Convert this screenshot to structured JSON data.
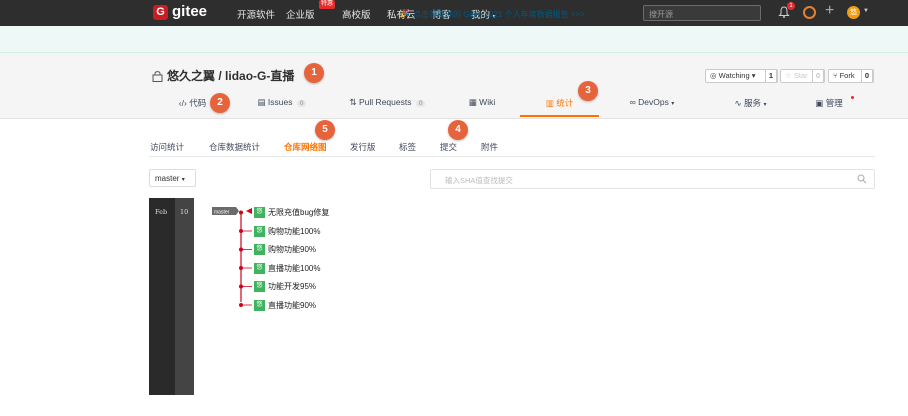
{
  "topnav": {
    "logo_letter": "G",
    "logo_text": "gitee",
    "items": [
      "开源软件",
      "企业版",
      "高校版",
      "私有云",
      "博客",
      "我的"
    ],
    "enterprise_badge": "特惠",
    "search_placeholder": "搜开源",
    "bell_count": "1",
    "avatar_letter": "悠"
  },
  "notice": {
    "icon": "🎉",
    "text": "点击领取你的 Gitee 2021 个人年度数据报告 >>>"
  },
  "repo": {
    "owner": "悠久之翼",
    "name": "lidao-G-直播",
    "separator": " / ",
    "watching_label": "Watching",
    "watching_count": "1",
    "star_label": "Star",
    "star_count": "0",
    "fork_label": "Fork",
    "fork_count": "0"
  },
  "tabs": [
    {
      "label": "代码",
      "icon": "code-icon"
    },
    {
      "label": "Issues",
      "count": "0",
      "icon": "issues-icon"
    },
    {
      "label": "Pull Requests",
      "count": "0",
      "icon": "pull-request-icon"
    },
    {
      "label": "Wiki",
      "icon": "wiki-icon"
    },
    {
      "label": "统计",
      "icon": "chart-icon",
      "active": true
    },
    {
      "label": "DevOps",
      "icon": "infinity-icon"
    },
    {
      "label": "服务",
      "icon": "pulse-icon"
    },
    {
      "label": "管理",
      "icon": "manage-icon"
    }
  ],
  "subnav": [
    "访问统计",
    "仓库数据统计",
    "仓库网络图",
    "发行版",
    "标签",
    "提交",
    "附件"
  ],
  "subnav_active": "仓库网络图",
  "branch_select": "master",
  "sha_placeholder": "输入SHA值查找提交",
  "graph": {
    "month": "Feb",
    "day": "10",
    "branch_label": "master",
    "commits": [
      {
        "avatar": "悠",
        "message": "无限充值bug修复"
      },
      {
        "avatar": "悠",
        "message": "购物功能100%"
      },
      {
        "avatar": "悠",
        "message": "购物功能90%"
      },
      {
        "avatar": "悠",
        "message": "直播功能100%"
      },
      {
        "avatar": "悠",
        "message": "功能开发95%"
      },
      {
        "avatar": "悠",
        "message": "直播功能90%"
      }
    ]
  },
  "markers": [
    "1",
    "2",
    "3",
    "4",
    "5"
  ],
  "colors": {
    "accent": "#fe7300",
    "topnav_bg": "#2e2e2e",
    "brand_red": "#c71d23",
    "marker": "#e5643c",
    "graph_line": "#d0021b",
    "commit_avatar": "#3fb45e"
  }
}
